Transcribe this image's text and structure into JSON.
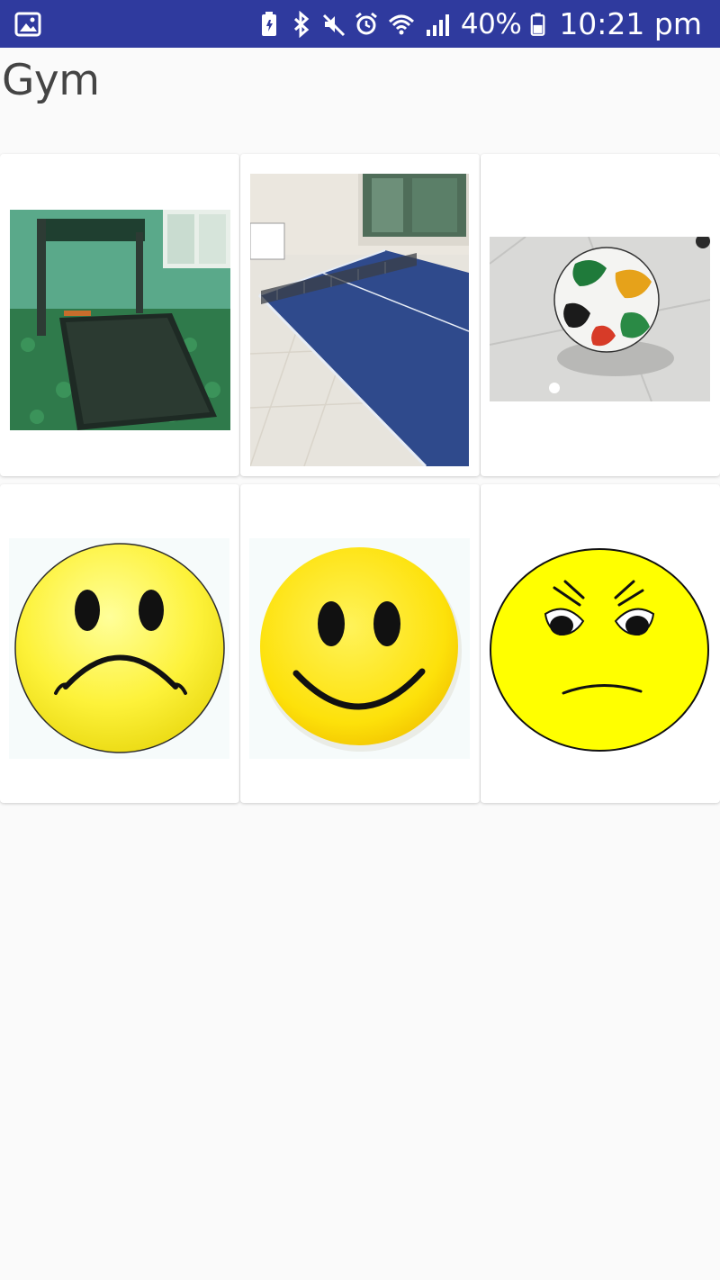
{
  "status_bar": {
    "left_icon": "image-notification-icon",
    "icons": [
      "battery-saver-icon",
      "bluetooth-icon",
      "mute-icon",
      "alarm-icon",
      "wifi-icon",
      "signal-icon"
    ],
    "battery_percent": "40%",
    "time": "10:21 pm",
    "background": "#2f3a9e"
  },
  "page": {
    "title": "Gym"
  },
  "grid": {
    "items": [
      {
        "image": "treadmill"
      },
      {
        "image": "ping-pong-table"
      },
      {
        "image": "soccer-ball"
      },
      {
        "image": "sad-face"
      },
      {
        "image": "happy-face"
      },
      {
        "image": "angry-face"
      }
    ]
  }
}
